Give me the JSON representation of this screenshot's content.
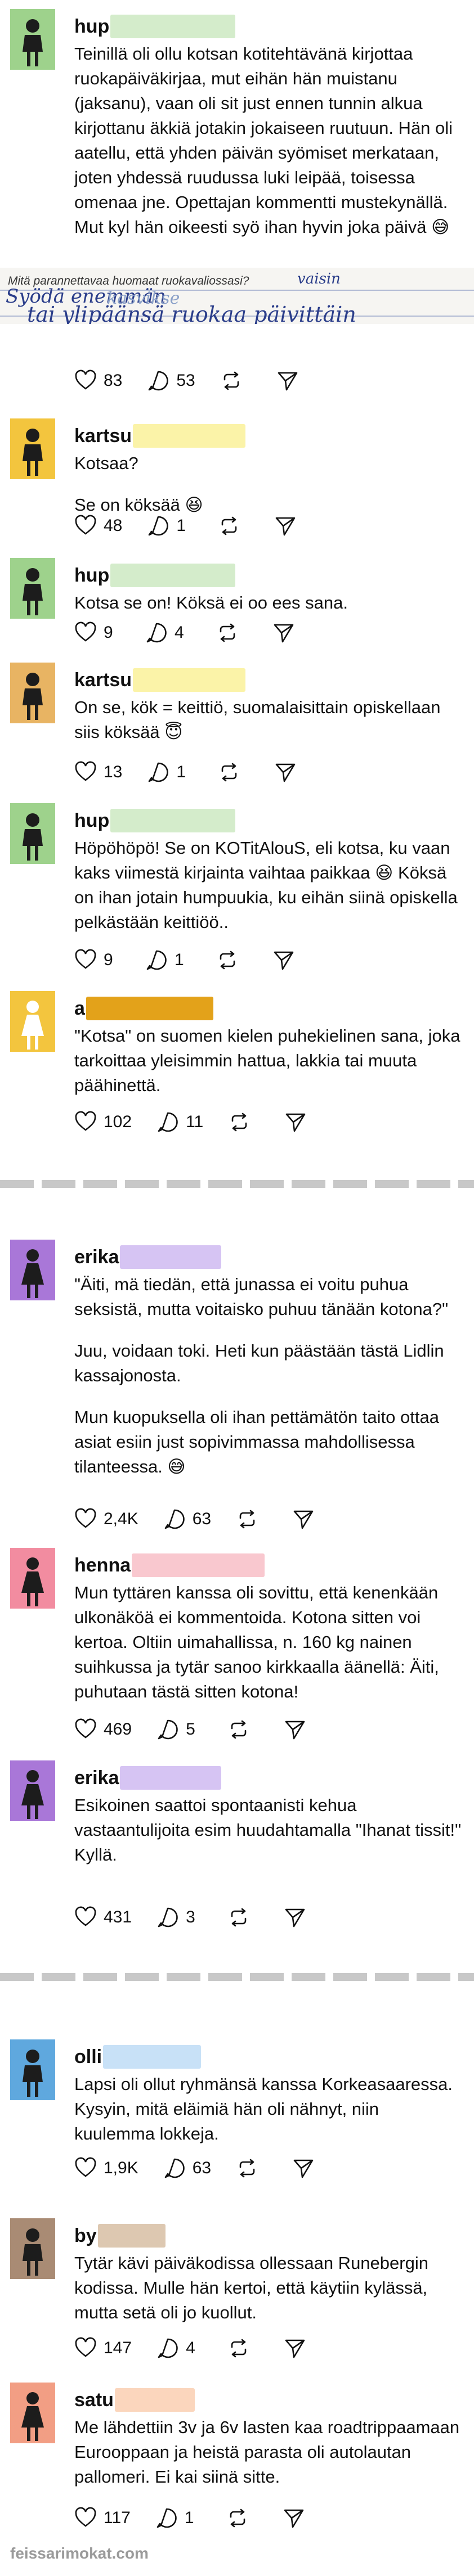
{
  "colors": {
    "green": "#9ed28c",
    "yellow": "#f3c53e",
    "orange": "#e8b463",
    "purple": "#a977d8",
    "pink": "#f28ca0",
    "blue": "#5fa8de",
    "brown": "#a98b74",
    "salmon": "#f29e84",
    "mask_green": "#d4eccb",
    "mask_yellow": "#fbf3a8",
    "mask_gold": "#e3a21a",
    "mask_purple": "#d6c4f3",
    "mask_pink": "#f9c8cf",
    "mask_blue": "#c8e1f7",
    "mask_tan": "#ddc8b1",
    "mask_peach": "#fbd6bd"
  },
  "posts": [
    {
      "username": "hup",
      "body": [
        "Teinillä oli ollu kotsan kotitehtävänä kirjottaa ruokapäiväkirjaa, mut eihän hän muistanu (jaksanu), vaan oli sit just ennen tunnin alkua kirjottanu äkkiä jotakin jokaiseen ruutuun. Hän oli aatellu, että yhden päivän syömiset merkataan, joten yhdessä ruudussa luki leipää, toisessa omenaa jne. Opettajan kommentti mustekynällä. Mut kyl hän oikeesti syö ihan hyvin joka päivä 😅"
      ],
      "note_image": {
        "print_line": "Mitä parannettavaa huomaat ruokavaliossasi?",
        "handwriting_1": "Syödä enemmän",
        "handwriting_2": "tai ylipäänsä ruokaa päivittäin",
        "handwriting_small": "vaisin"
      },
      "likes": "83",
      "replies": "53"
    },
    {
      "username": "kartsu",
      "body": [
        "Kotsaa?",
        "Se on köksää 😆"
      ],
      "likes": "48",
      "replies": "1"
    },
    {
      "username": "hup",
      "body": [
        "Kotsa se on! Köksä ei oo ees sana."
      ],
      "likes": "9",
      "replies": "4"
    },
    {
      "username": "kartsu",
      "body": [
        "On se, kök = keittiö, suomalaisittain opiskellaan siis köksää 😇"
      ],
      "likes": "13",
      "replies": "1"
    },
    {
      "username": "hup",
      "body": [
        "Höpöhöpö! Se on KOTitAlouS, eli kotsa, ku vaan kaks viimestä kirjainta vaihtaa paikkaa 😆 Köksä on ihan jotain humpuukia, ku eihän siinä opiskella pelkästään keittiöö.."
      ],
      "likes": "9",
      "replies": "1"
    },
    {
      "username": "a",
      "body": [
        "\"Kotsa\" on suomen kielen puhekielinen sana, joka tarkoittaa yleisimmin hattua, lakkia tai muuta päähinettä."
      ],
      "likes": "102",
      "replies": "11"
    },
    {
      "username": "erika",
      "body": [
        "\"Äiti, mä tiedän, että junassa ei voitu puhua seksistä, mutta voitaisko puhuu tänään kotona?\"",
        "Juu, voidaan toki. Heti kun päästään tästä Lidlin kassajonosta.",
        "Mun kuopuksella  oli ihan pettämätön taito ottaa asiat esiin just sopivimmassa mahdollisessa tilanteessa. 😅"
      ],
      "likes": "2,4K",
      "replies": "63"
    },
    {
      "username": "henna",
      "body": [
        "Mun tyttären kanssa oli sovittu, että kenenkään ulkonäköä ei kommentoida. Kotona sitten voi kertoa. Oltiin uimahallissa, n. 160 kg nainen suihkussa ja tytär sanoo kirkkaalla äänellä: Äiti, puhutaan tästä sitten kotona!"
      ],
      "likes": "469",
      "replies": "5"
    },
    {
      "username": "erika",
      "body": [
        "Esikoinen saattoi spontaanisti kehua vastaantulijoita esim huudahtamalla \"Ihanat tissit!\"\nKyllä."
      ],
      "likes": "431",
      "replies": "3"
    },
    {
      "username": "olli",
      "body": [
        "Lapsi oli ollut ryhmänsä kanssa Korkeasaaressa. Kysyin, mitä eläimiä hän oli nähnyt, niin kuulemma lokkeja."
      ],
      "likes": "1,9K",
      "replies": "63"
    },
    {
      "username": "by",
      "body": [
        "Tytär kävi päiväkodissa ollessaan Runebergin kodissa. Mulle hän kertoi, että käytiin kylässä, mutta setä oli jo kuollut."
      ],
      "likes": "147",
      "replies": "4"
    },
    {
      "username": "satu",
      "body": [
        "Me lähdettiin 3v ja 6v lasten kaa roadtrippaamaan Eurooppaan ja heistä parasta oli autolautan pallomeri. Ei kai siinä sitte."
      ],
      "likes": "117",
      "replies": "1"
    }
  ],
  "watermark": "feissarimokat.com"
}
